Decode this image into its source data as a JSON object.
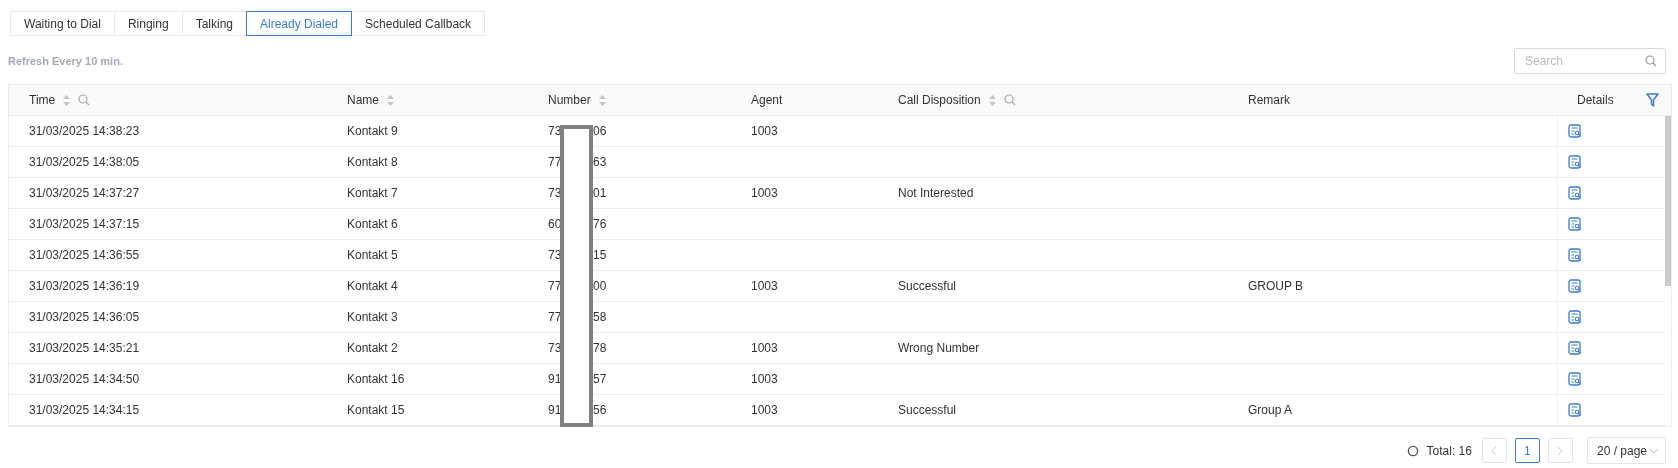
{
  "tabs": [
    {
      "label": "Waiting to Dial",
      "selected": false
    },
    {
      "label": "Ringing",
      "selected": false
    },
    {
      "label": "Talking",
      "selected": false
    },
    {
      "label": "Already Dialed",
      "selected": true
    },
    {
      "label": "Scheduled Callback",
      "selected": false
    }
  ],
  "refresh_note": "Refresh Every 10 min.",
  "search": {
    "placeholder": "Search"
  },
  "table": {
    "columns": [
      {
        "label": "Time",
        "sortable": true,
        "searchable": true
      },
      {
        "label": "Name",
        "sortable": true,
        "searchable": false
      },
      {
        "label": "Number",
        "sortable": true,
        "searchable": false
      },
      {
        "label": "Agent",
        "sortable": false,
        "searchable": false
      },
      {
        "label": "Call Disposition",
        "sortable": true,
        "searchable": true
      },
      {
        "label": "Remark",
        "sortable": false,
        "searchable": false
      },
      {
        "label": "Details",
        "sortable": false,
        "searchable": false
      }
    ],
    "rows": [
      {
        "time": "31/03/2025 14:38:23",
        "name": "Kontakt 9",
        "number_start": "73",
        "number_end": "06",
        "agent": "1003",
        "disposition": "",
        "remark": ""
      },
      {
        "time": "31/03/2025 14:38:05",
        "name": "Kontakt 8",
        "number_start": "77",
        "number_end": "63",
        "agent": "",
        "disposition": "",
        "remark": ""
      },
      {
        "time": "31/03/2025 14:37:27",
        "name": "Kontakt 7",
        "number_start": "73",
        "number_end": "01",
        "agent": "1003",
        "disposition": "Not Interested",
        "remark": ""
      },
      {
        "time": "31/03/2025 14:37:15",
        "name": "Kontakt 6",
        "number_start": "60",
        "number_end": "76",
        "agent": "",
        "disposition": "",
        "remark": ""
      },
      {
        "time": "31/03/2025 14:36:55",
        "name": "Kontakt 5",
        "number_start": "73",
        "number_end": "15",
        "agent": "",
        "disposition": "",
        "remark": ""
      },
      {
        "time": "31/03/2025 14:36:19",
        "name": "Kontakt 4",
        "number_start": "77",
        "number_end": "00",
        "agent": "1003",
        "disposition": "Successful",
        "remark": "GROUP B"
      },
      {
        "time": "31/03/2025 14:36:05",
        "name": "Kontakt 3",
        "number_start": "77",
        "number_end": "58",
        "agent": "",
        "disposition": "",
        "remark": ""
      },
      {
        "time": "31/03/2025 14:35:21",
        "name": "Kontakt 2",
        "number_start": "73",
        "number_end": "78",
        "agent": "1003",
        "disposition": "Wrong Number",
        "remark": ""
      },
      {
        "time": "31/03/2025 14:34:50",
        "name": "Kontakt 16",
        "number_start": "91",
        "number_end": "57",
        "agent": "1003",
        "disposition": "",
        "remark": ""
      },
      {
        "time": "31/03/2025 14:34:15",
        "name": "Kontakt 15",
        "number_start": "91",
        "number_end": "56",
        "agent": "1003",
        "disposition": "Successful",
        "remark": "Group A"
      }
    ]
  },
  "pagination": {
    "total": "Total: 16",
    "pages": [
      {
        "label": "1",
        "selected": true
      }
    ],
    "prev_disabled": true,
    "next_disabled": true,
    "page_size": "20 / page"
  }
}
